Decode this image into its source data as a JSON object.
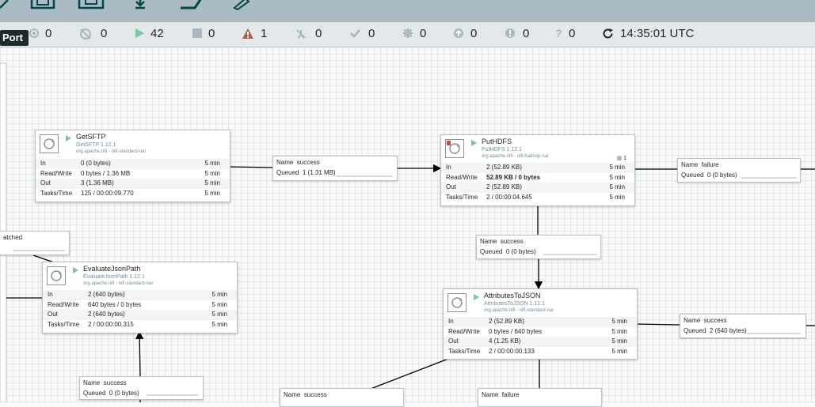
{
  "toolbar": {
    "icons": [
      "funnel-icon",
      "template-icon",
      "upload-icon",
      "label-icon",
      "pencil-icon"
    ]
  },
  "tooltip": {
    "text": "Port"
  },
  "status": {
    "items": [
      {
        "icon": "transmitting-icon",
        "value": "0"
      },
      {
        "icon": "not-transmitting-icon",
        "value": "0"
      },
      {
        "icon": "running-icon",
        "value": "42"
      },
      {
        "icon": "stopped-icon",
        "value": "0"
      },
      {
        "icon": "invalid-icon",
        "value": "1"
      },
      {
        "icon": "disabled-icon",
        "value": "0"
      },
      {
        "icon": "up-to-date-icon",
        "value": "0"
      },
      {
        "icon": "locally-modified-icon",
        "value": "0"
      },
      {
        "icon": "stale-icon",
        "value": "0"
      },
      {
        "icon": "locally-modified-and-stale-icon",
        "value": "0"
      },
      {
        "icon": "sync-failure-icon",
        "value": "0"
      }
    ],
    "time": "14:35:01 UTC"
  },
  "processors": {
    "getsftp": {
      "name": "GetSFTP",
      "type": "GetSFTP 1.12.1",
      "bundle": "org.apache.nifi - nifi-standard-nar",
      "rows": [
        {
          "label": "In",
          "value": "0 (0 bytes)",
          "time": "5 min"
        },
        {
          "label": "Read/Write",
          "value": "0 bytes / 1.36 MB",
          "time": "5 min"
        },
        {
          "label": "Out",
          "value": "3 (1.36 MB)",
          "time": "5 min"
        },
        {
          "label": "Tasks/Time",
          "value": "125 / 00:00:09.770",
          "time": "5 min"
        }
      ]
    },
    "puthdfs": {
      "name": "PutHDFS",
      "type": "PutHDFS 1.12.1",
      "bundle": "org.apache.nifi - nifi-hadoop-nar",
      "threads": "1",
      "rows": [
        {
          "label": "In",
          "value": "2 (52.89 KB)",
          "time": "5 min"
        },
        {
          "label": "Read/Write",
          "value": "52.89 KB / 0 bytes",
          "time": "5 min"
        },
        {
          "label": "Out",
          "value": "2 (52.89 KB)",
          "time": "5 min"
        },
        {
          "label": "Tasks/Time",
          "value": "2 / 00:00:04.645",
          "time": "5 min"
        }
      ]
    },
    "evaluatejsonpath": {
      "name": "EvaluateJsonPath",
      "type": "EvaluateJsonPath 1.12.1",
      "bundle": "org.apache.nifi - nifi-standard-nar",
      "rows": [
        {
          "label": "In",
          "value": "2 (640 bytes)",
          "time": "5 min"
        },
        {
          "label": "Read/Write",
          "value": "640 bytes / 0 bytes",
          "time": "5 min"
        },
        {
          "label": "Out",
          "value": "2 (640 bytes)",
          "time": "5 min"
        },
        {
          "label": "Tasks/Time",
          "value": "2 / 00:00:00.315",
          "time": "5 min"
        }
      ]
    },
    "attributestojson": {
      "name": "AttributesToJSON",
      "type": "AttributesToJSON 1.12.1",
      "bundle": "org.apache.nifi - nifi-standard-nar",
      "rows": [
        {
          "label": "In",
          "value": "2 (52.89 KB)",
          "time": "5 min"
        },
        {
          "label": "Read/Write",
          "value": "0 bytes / 640 bytes",
          "time": "5 min"
        },
        {
          "label": "Out",
          "value": "4 (1.25 KB)",
          "time": "5 min"
        },
        {
          "label": "Tasks/Time",
          "value": "2 / 00:00:00.133",
          "time": "5 min"
        }
      ]
    }
  },
  "connections": {
    "sftp_to_hdfs": {
      "name_label": "Name",
      "name": "success",
      "queued_label": "Queued",
      "queued": "1 (1.31 MB)"
    },
    "hdfs_failure": {
      "name_label": "Name",
      "name": "failure",
      "queued_label": "Queued",
      "queued": "0 (0 bytes)"
    },
    "hdfs_to_attr": {
      "name_label": "Name",
      "name": "success",
      "queued_label": "Queued",
      "queued": "0 (0 bytes)"
    },
    "attr_success": {
      "name_label": "Name",
      "name": "success",
      "queued_label": "Queued",
      "queued": "2 (640 bytes)"
    },
    "eval_in": {
      "name_label": "Name",
      "name": "success",
      "queued_label": "Queued",
      "queued": "0 (0 bytes)"
    },
    "matched": {
      "name": "atched"
    },
    "bottom_success": {
      "name_label": "Name",
      "name": "success"
    },
    "bottom_failure": {
      "name_label": "Name",
      "name": "failure"
    }
  }
}
